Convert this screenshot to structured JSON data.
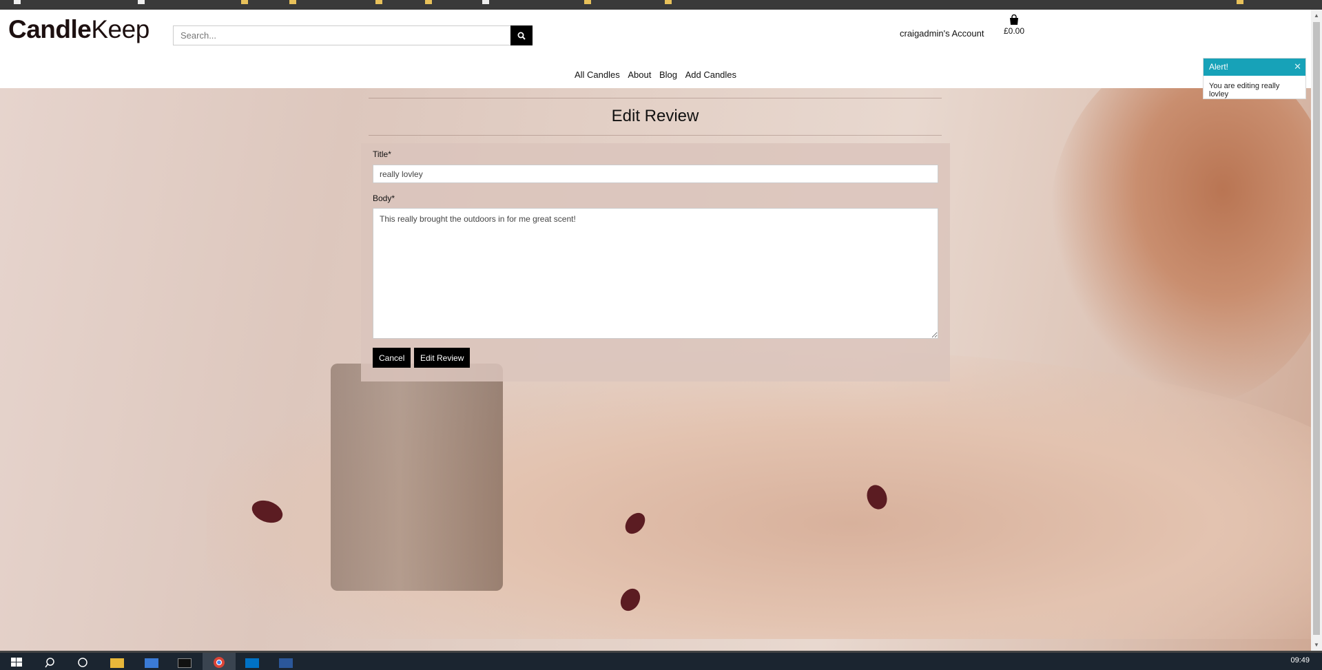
{
  "brand": {
    "name_bold": "Candle",
    "name_light": "Keep"
  },
  "search": {
    "placeholder": "Search..."
  },
  "header": {
    "account_label": "craigadmin's Account",
    "bag_total": "£0.00"
  },
  "nav": {
    "items": [
      "All Candles",
      "About",
      "Blog",
      "Add Candles"
    ]
  },
  "alert": {
    "title": "Alert!",
    "message": "You are editing really lovley"
  },
  "form": {
    "heading": "Edit Review",
    "title_label": "Title*",
    "title_value": "really lovley",
    "body_label": "Body*",
    "body_value": "This really brought the outdoors in for me great scent!",
    "cancel_label": "Cancel",
    "submit_label": "Edit Review"
  },
  "taskbar": {
    "clock": "09:49"
  },
  "colors": {
    "alert_header": "#17a2b8",
    "button": "#000000"
  }
}
